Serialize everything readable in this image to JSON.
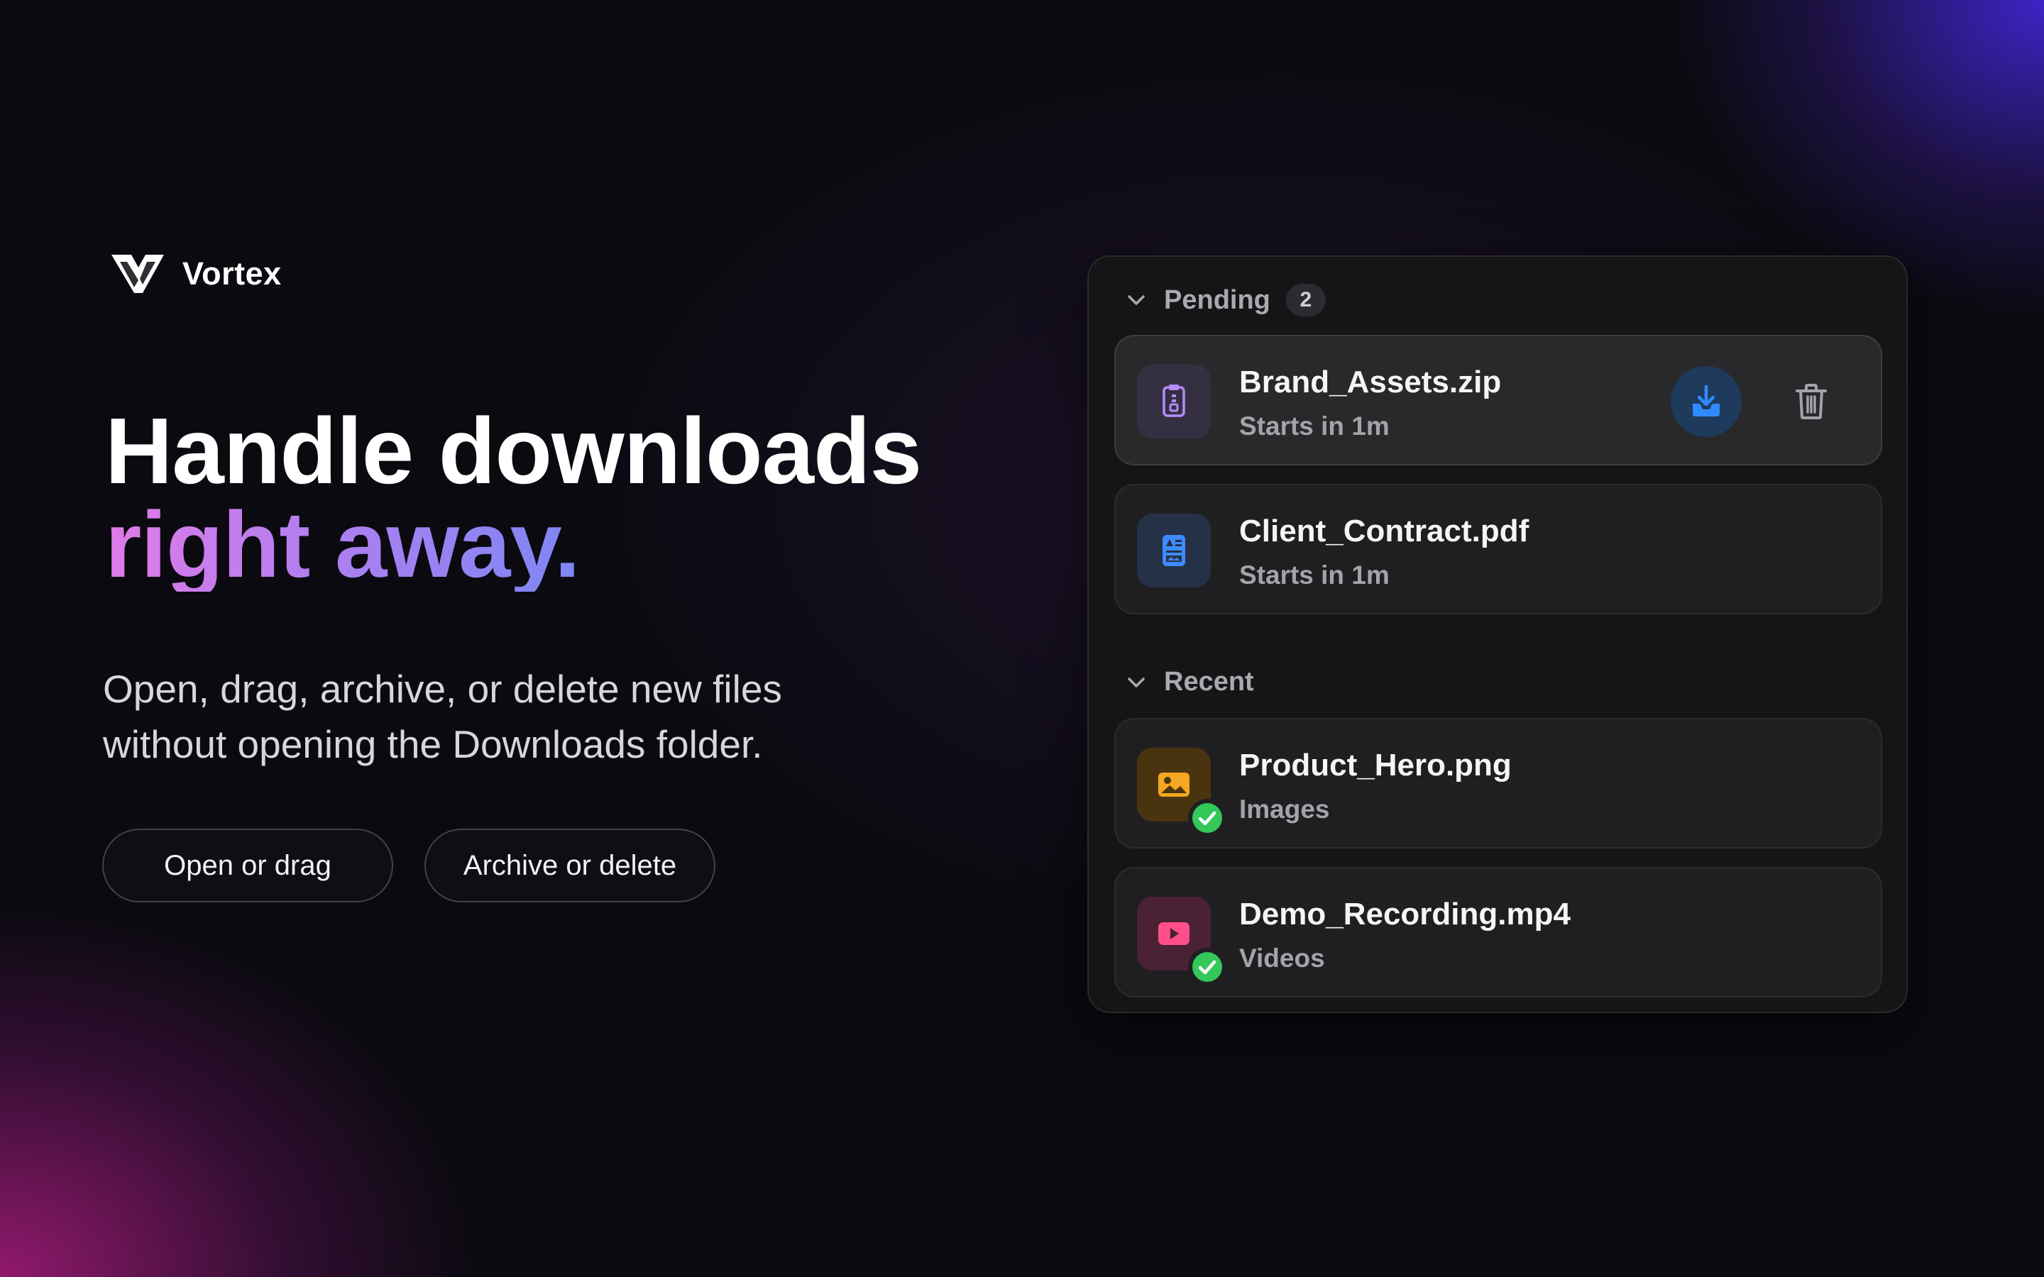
{
  "brand": {
    "name": "Vortex",
    "logo_icon": "vortex-v-logo"
  },
  "hero": {
    "headline_line1": "Handle downloads",
    "headline_line2": "right away.",
    "subhead_line1": "Open, drag, archive, or delete new files",
    "subhead_line2": "without opening the Downloads folder.",
    "cta_open": "Open or drag",
    "cta_archive": "Archive or delete"
  },
  "panel": {
    "pending": {
      "title": "Pending",
      "count": "2",
      "items": [
        {
          "name": "Brand_Assets.zip",
          "status": "Starts in 1m",
          "icon": "zip-file-icon"
        },
        {
          "name": "Client_Contract.pdf",
          "status": "Starts in 1m",
          "icon": "document-icon"
        }
      ]
    },
    "recent": {
      "title": "Recent",
      "items": [
        {
          "name": "Product_Hero.png",
          "category": "Images",
          "icon": "image-icon"
        },
        {
          "name": "Demo_Recording.mp4",
          "category": "Videos",
          "icon": "video-icon"
        }
      ]
    }
  },
  "colors": {
    "gradient_start": "#e07be8",
    "gradient_end": "#7d86f5",
    "download_accent": "#2f8cff",
    "check_green": "#34c759"
  }
}
